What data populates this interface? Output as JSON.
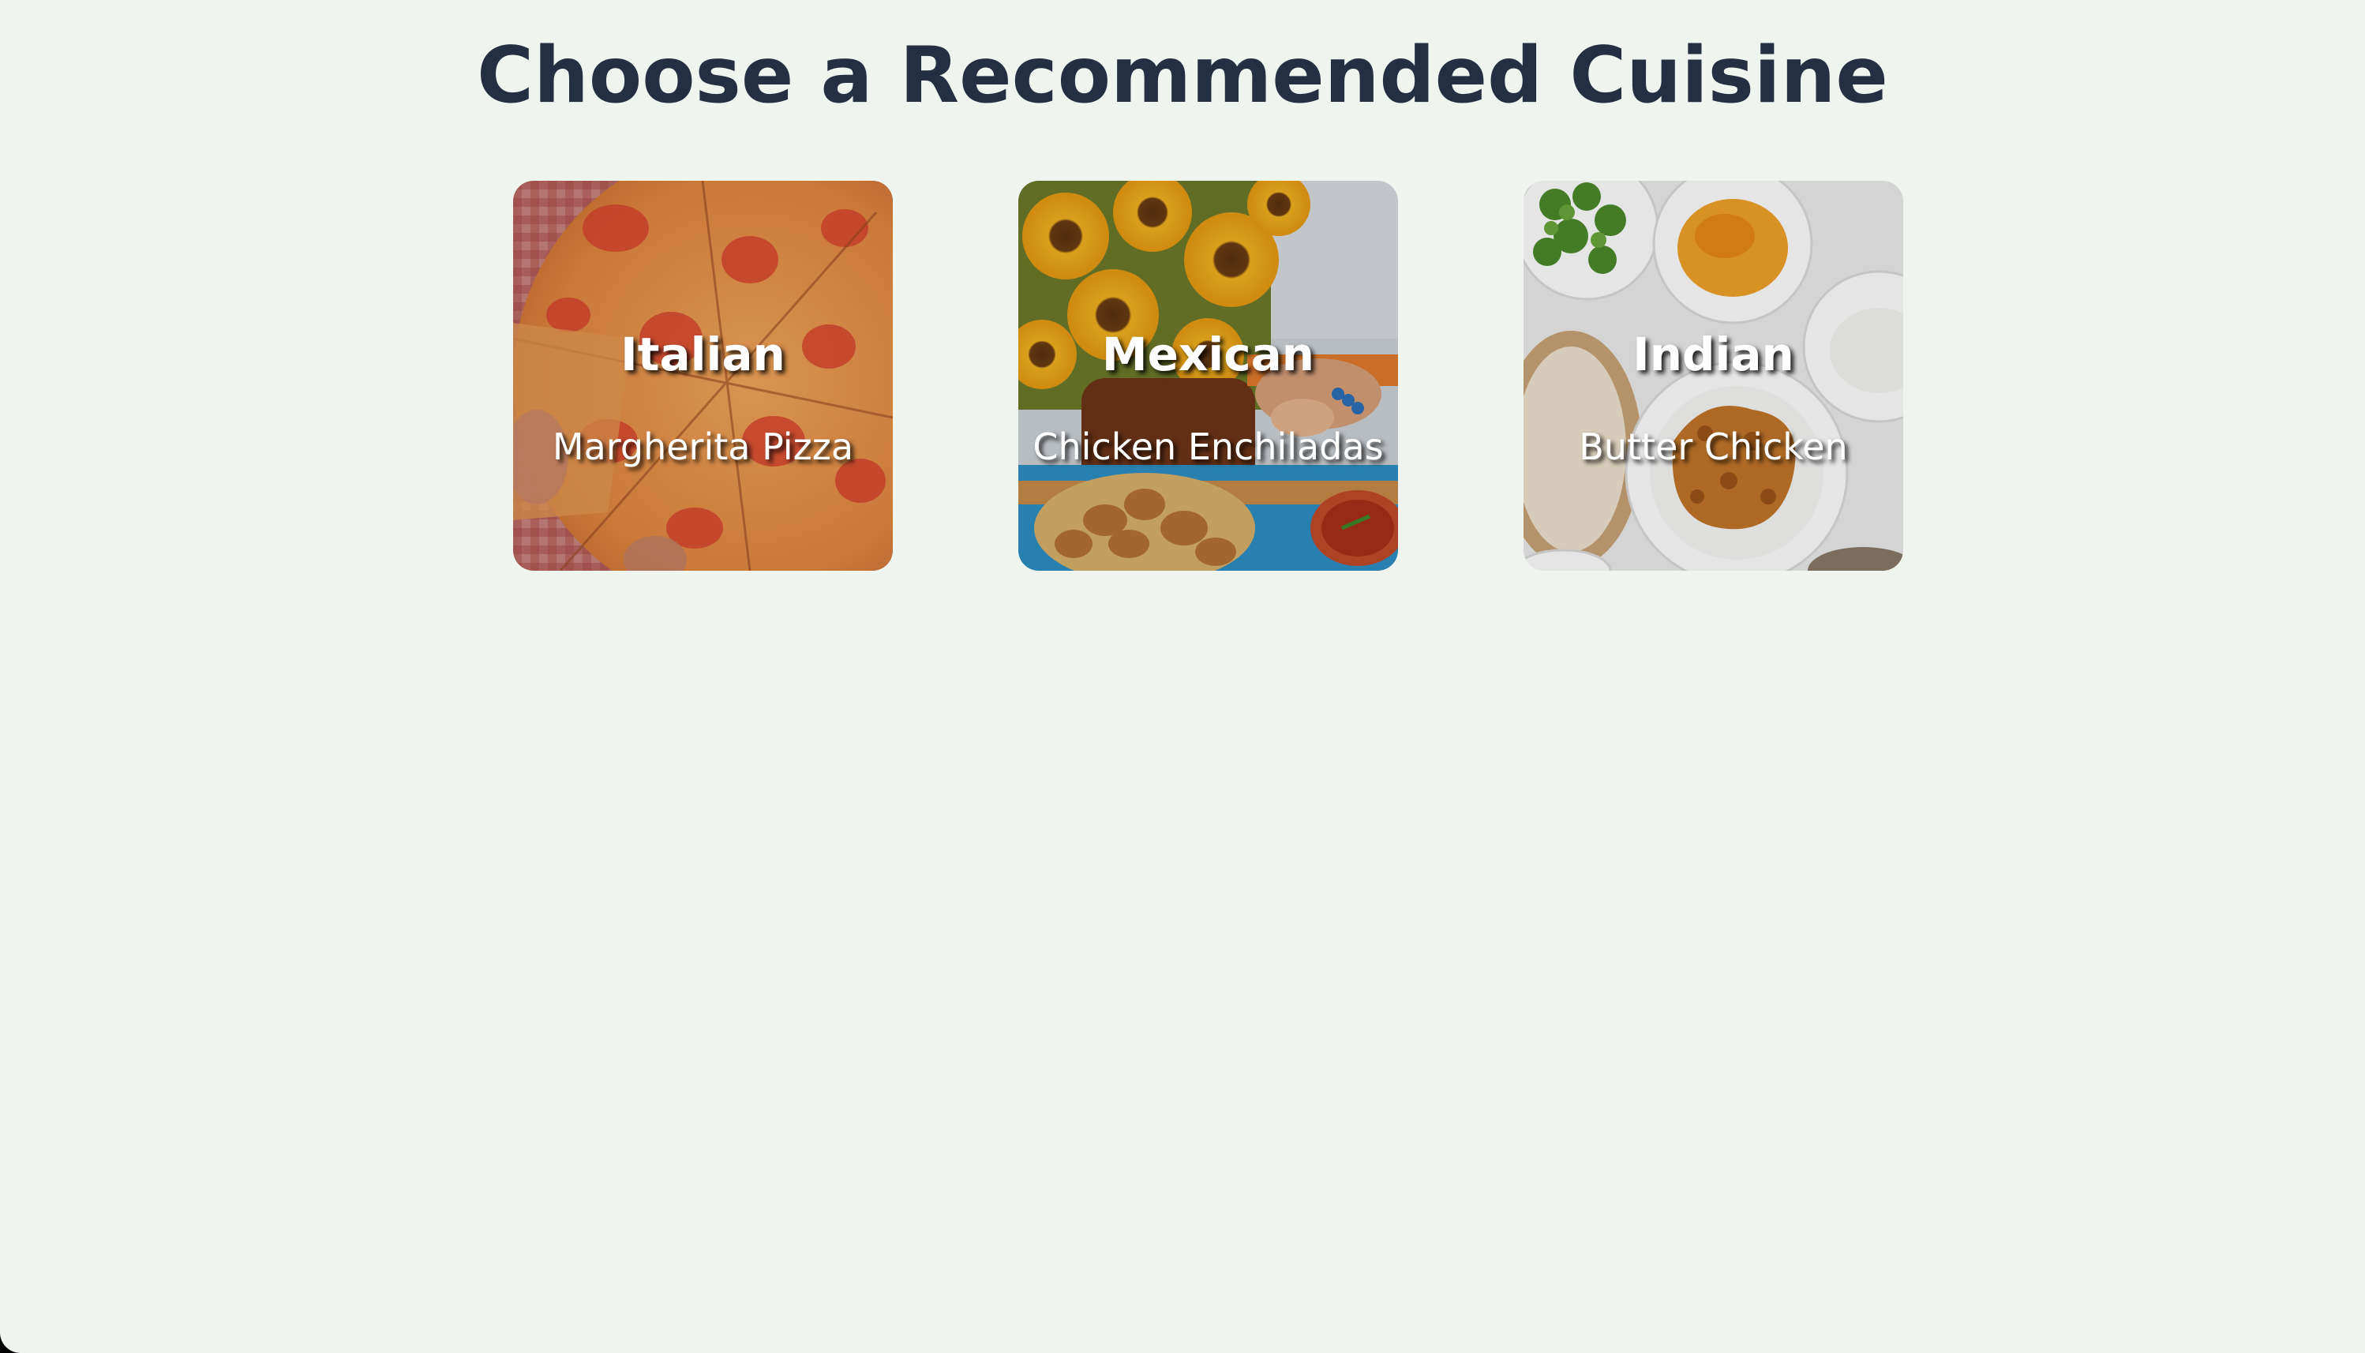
{
  "header": {
    "title": "Choose a Recommended Cuisine"
  },
  "cards": [
    {
      "cuisine": "Italian",
      "dish": "Margherita Pizza",
      "image": "pizza-photo"
    },
    {
      "cuisine": "Mexican",
      "dish": "Chicken Enchiladas",
      "image": "sunflowers-and-mexican-food-photo"
    },
    {
      "cuisine": "Indian",
      "dish": "Butter Chicken",
      "image": "butter-chicken-plates-photo"
    }
  ],
  "colors": {
    "background": "#eff4ef",
    "title": "#243042",
    "card_text": "#ffffff"
  }
}
